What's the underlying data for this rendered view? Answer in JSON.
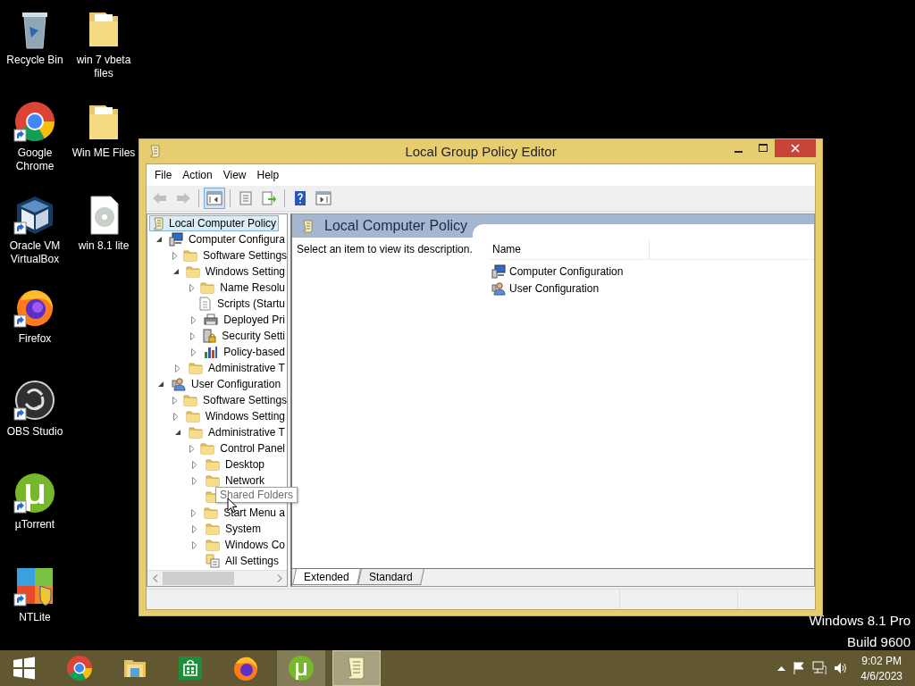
{
  "desktop": {
    "icons": [
      {
        "kind": "recycle-bin",
        "label": "Recycle Bin",
        "shortcut": false
      },
      {
        "kind": "folder",
        "label": "win 7 vbeta files",
        "shortcut": false
      },
      {
        "kind": "chrome",
        "label": "Google Chrome",
        "shortcut": true
      },
      {
        "kind": "folder",
        "label": "Win ME Files",
        "shortcut": false
      },
      {
        "kind": "virtualbox",
        "label": "Oracle VM VirtualBox",
        "shortcut": true
      },
      {
        "kind": "disc-image",
        "label": "win 8.1 lite",
        "shortcut": false
      },
      {
        "kind": "firefox",
        "label": "Firefox",
        "shortcut": true
      },
      {
        "kind": "obs",
        "label": "OBS Studio",
        "shortcut": true
      },
      {
        "kind": "utorrent",
        "label": "µTorrent",
        "shortcut": true
      },
      {
        "kind": "ntlite",
        "label": "NTLite",
        "shortcut": true
      }
    ],
    "watermark": [
      "Windows 8.1 Pro",
      "Build 9600"
    ]
  },
  "window": {
    "title": "Local Group Policy Editor",
    "menu": [
      "File",
      "Action",
      "View",
      "Help"
    ],
    "toolbar": [
      [
        {
          "kind": "back",
          "disabled": true,
          "pressed": false
        },
        {
          "kind": "forward",
          "disabled": true,
          "pressed": false
        }
      ],
      [
        {
          "kind": "console-tree",
          "disabled": false,
          "pressed": true
        }
      ],
      [
        {
          "kind": "properties",
          "disabled": false,
          "pressed": false
        },
        {
          "kind": "export",
          "disabled": false,
          "pressed": false
        }
      ],
      [
        {
          "kind": "help",
          "disabled": false,
          "pressed": false
        },
        {
          "kind": "action-pane",
          "disabled": false,
          "pressed": false
        }
      ]
    ],
    "tree": {
      "label": "Local Computer Policy",
      "kind": "policy",
      "selected": true,
      "children": [
        {
          "label": "Computer Configura",
          "kind": "computer",
          "expandable": true,
          "expanded": true,
          "selected": false,
          "children": [
            {
              "label": "Software Settings",
              "kind": "folder",
              "expandable": true,
              "expanded": false,
              "selected": false
            },
            {
              "label": "Windows Setting",
              "kind": "folder",
              "expandable": true,
              "expanded": true,
              "selected": false,
              "children": [
                {
                  "label": "Name Resolu",
                  "kind": "folder",
                  "expandable": true,
                  "expanded": false,
                  "selected": false
                },
                {
                  "label": "Scripts (Startu",
                  "kind": "script",
                  "expandable": false,
                  "selected": false
                },
                {
                  "label": "Deployed Pri",
                  "kind": "printer",
                  "expandable": true,
                  "expanded": false,
                  "selected": false
                },
                {
                  "label": "Security Setti",
                  "kind": "security",
                  "expandable": true,
                  "expanded": false,
                  "selected": false
                },
                {
                  "label": "Policy-based",
                  "kind": "chart",
                  "expandable": true,
                  "expanded": false,
                  "selected": false
                }
              ]
            },
            {
              "label": "Administrative T",
              "kind": "folder",
              "expandable": true,
              "expanded": false,
              "selected": false
            }
          ]
        },
        {
          "label": "User Configuration",
          "kind": "user",
          "expandable": true,
          "expanded": true,
          "selected": false,
          "children": [
            {
              "label": "Software Settings",
              "kind": "folder",
              "expandable": true,
              "expanded": false,
              "selected": false
            },
            {
              "label": "Windows Setting",
              "kind": "folder",
              "expandable": true,
              "expanded": false,
              "selected": false
            },
            {
              "label": "Administrative T",
              "kind": "folder",
              "expandable": true,
              "expanded": true,
              "selected": false,
              "children": [
                {
                  "label": "Control Panel",
                  "kind": "folder",
                  "expandable": true,
                  "expanded": false,
                  "selected": false
                },
                {
                  "label": "Desktop",
                  "kind": "folder",
                  "expandable": true,
                  "expanded": false,
                  "selected": false
                },
                {
                  "label": "Network",
                  "kind": "folder",
                  "expandable": true,
                  "expanded": false,
                  "selected": false
                },
                {
                  "kind": "folder",
                  "expandable": false,
                  "selected": false
                },
                {
                  "label": "Start Menu a",
                  "kind": "folder",
                  "expandable": true,
                  "expanded": false,
                  "selected": false
                },
                {
                  "label": "System",
                  "kind": "folder",
                  "expandable": true,
                  "expanded": false,
                  "selected": false
                },
                {
                  "label": "Windows Co",
                  "kind": "folder",
                  "expandable": true,
                  "expanded": false,
                  "selected": false
                },
                {
                  "label": "All Settings",
                  "kind": "settings",
                  "expandable": false,
                  "selected": false
                }
              ]
            }
          ]
        }
      ]
    },
    "tooltip": "Shared Folders",
    "details": {
      "title": "Local Computer Policy",
      "description": "Select an item to view its description.",
      "columns": [
        "Name"
      ],
      "rows": [
        {
          "kind": "computer",
          "name": "Computer Configuration",
          "selected": false
        },
        {
          "kind": "user",
          "name": "User Configuration",
          "selected": false
        }
      ]
    },
    "tabs": [
      {
        "label": "Extended",
        "selected": true
      },
      {
        "label": "Standard",
        "selected": false
      }
    ]
  },
  "taskbar": {
    "items": [
      {
        "kind": "start",
        "open": false,
        "focused": false
      },
      {
        "kind": "chrome",
        "open": false,
        "focused": false
      },
      {
        "kind": "explorer",
        "open": false,
        "focused": false
      },
      {
        "kind": "store",
        "open": false,
        "focused": false
      },
      {
        "kind": "firefox",
        "open": false,
        "focused": false
      },
      {
        "kind": "utorrent",
        "open": true,
        "focused": false
      },
      {
        "kind": "gpedit",
        "open": true,
        "focused": true
      }
    ],
    "time": "9:02 PM",
    "date": "4/6/2023"
  }
}
